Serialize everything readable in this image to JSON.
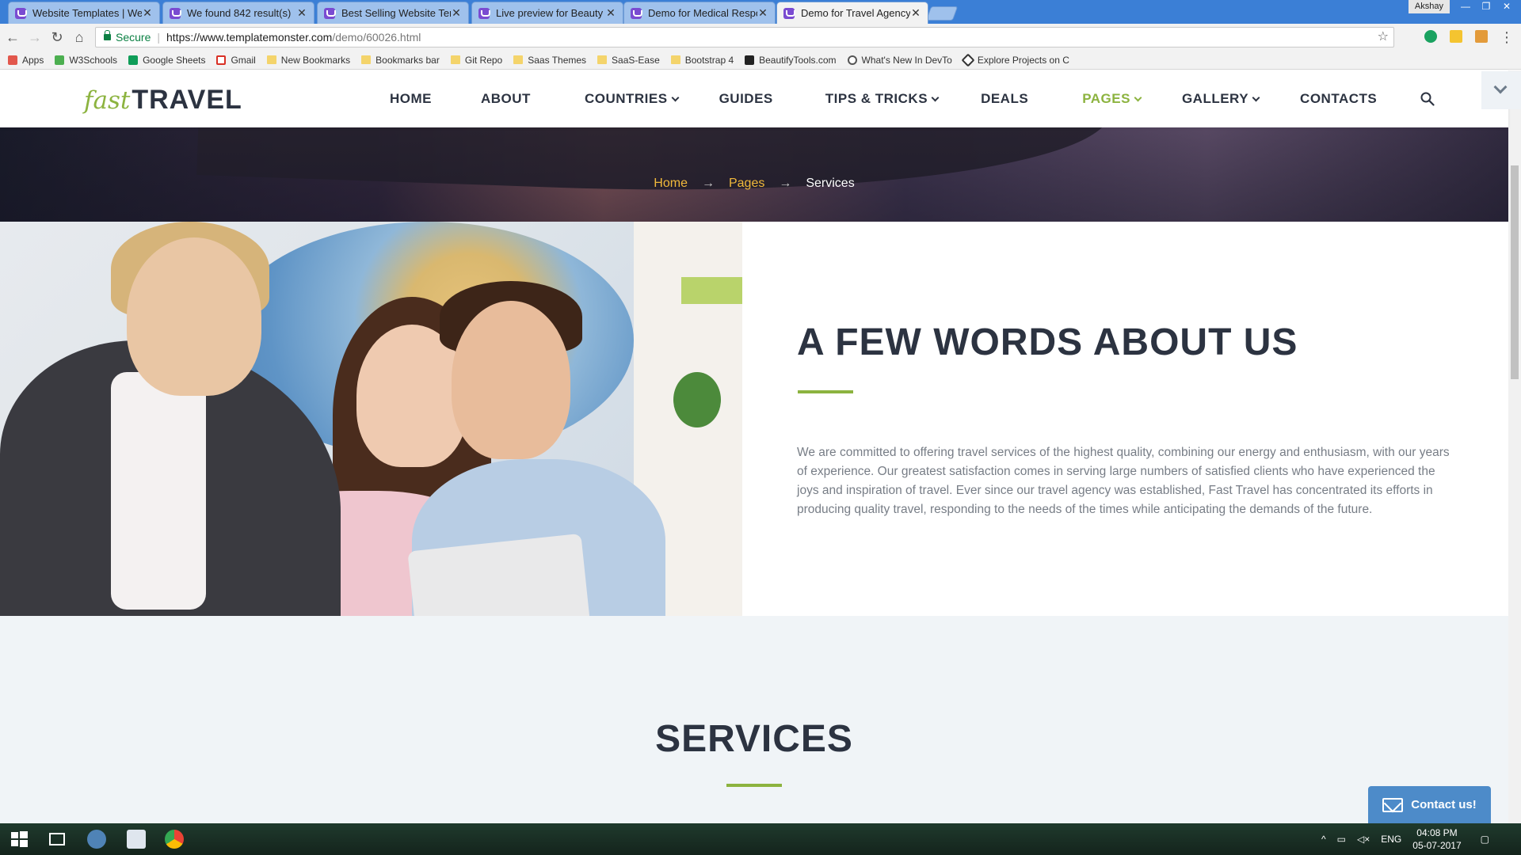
{
  "browser": {
    "tabs": [
      {
        "title": "Website Templates | Web"
      },
      {
        "title": "We found 842 result(s)"
      },
      {
        "title": "Best Selling Website Tem"
      },
      {
        "title": "Live preview for Beauty F"
      },
      {
        "title": "Demo for Medical Respo"
      },
      {
        "title": "Demo for Travel Agency"
      }
    ],
    "user_name": "Akshay",
    "secure_label": "Secure",
    "url_host": "https://www.templatemonster.com",
    "url_path": "/demo/60026.html",
    "bookmarks": [
      {
        "label": "Apps"
      },
      {
        "label": "W3Schools"
      },
      {
        "label": "Google Sheets"
      },
      {
        "label": "Gmail"
      },
      {
        "label": "New Bookmarks"
      },
      {
        "label": "Bookmarks bar"
      },
      {
        "label": "Git Repo"
      },
      {
        "label": "Saas Themes"
      },
      {
        "label": "SaaS-Ease"
      },
      {
        "label": "Bootstrap 4"
      },
      {
        "label": "BeautifyTools.com"
      },
      {
        "label": "What's New In DevTo"
      },
      {
        "label": "Explore Projects on C"
      }
    ]
  },
  "site": {
    "logo_fast": "fast",
    "logo_travel": "TRAVEL",
    "nav": [
      {
        "label": "HOME"
      },
      {
        "label": "ABOUT"
      },
      {
        "label": "COUNTRIES"
      },
      {
        "label": "GUIDES"
      },
      {
        "label": "TIPS & TRICKS"
      },
      {
        "label": "DEALS"
      },
      {
        "label": "PAGES"
      },
      {
        "label": "GALLERY"
      },
      {
        "label": "CONTACTS"
      }
    ],
    "breadcrumb": {
      "home": "Home",
      "pages": "Pages",
      "current": "Services"
    },
    "about": {
      "heading": "A FEW WORDS ABOUT US",
      "body": "We are committed to offering travel services of the highest quality, combining our energy and enthusiasm, with our years of experience. Our greatest satisfaction comes in serving large numbers of satisfied clients who have experienced the joys and inspiration of travel. Ever since our travel agency was established, Fast Travel has concentrated its efforts in producing quality travel, responding to the needs of the times while anticipating the demands of the future."
    },
    "services_heading": "SERVICES",
    "contact_button": "Contact us!"
  },
  "taskbar": {
    "lang": "ENG",
    "time": "04:08 PM",
    "date": "05-07-2017"
  },
  "colors": {
    "accent": "#8cb33f",
    "heading": "#2c3341",
    "breadcrumb": "#f1b93b",
    "contact": "#4d8bc9"
  }
}
